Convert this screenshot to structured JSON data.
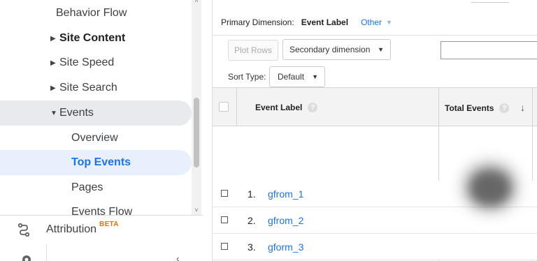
{
  "sidebar": {
    "behavior_flow": "Behavior Flow",
    "site_content": "Site Content",
    "site_speed": "Site Speed",
    "site_search": "Site Search",
    "events": "Events",
    "overview": "Overview",
    "top_events": "Top Events",
    "pages": "Pages",
    "events_flow": "Events Flow",
    "attribution": "Attribution",
    "attribution_badge": "BETA"
  },
  "toolbar": {
    "primary_dimension_label": "Primary Dimension:",
    "primary_dimension_value": "Event Label",
    "other_label": "Other",
    "plot_rows": "Plot Rows",
    "secondary_dimension": "Secondary dimension",
    "sort_type_label": "Sort Type:",
    "sort_type_value": "Default",
    "search_value": ""
  },
  "table": {
    "columns": {
      "event_label": "Event Label",
      "total_events": "Total Events"
    },
    "rows": [
      {
        "index": "1.",
        "label": "gfrom_1"
      },
      {
        "index": "2.",
        "label": "gfrom_2"
      },
      {
        "index": "3.",
        "label": "gform_3"
      }
    ]
  },
  "colors": {
    "accent": "#1a73e8",
    "active_pill": "#e8f0fe",
    "beta": "#e37400"
  }
}
